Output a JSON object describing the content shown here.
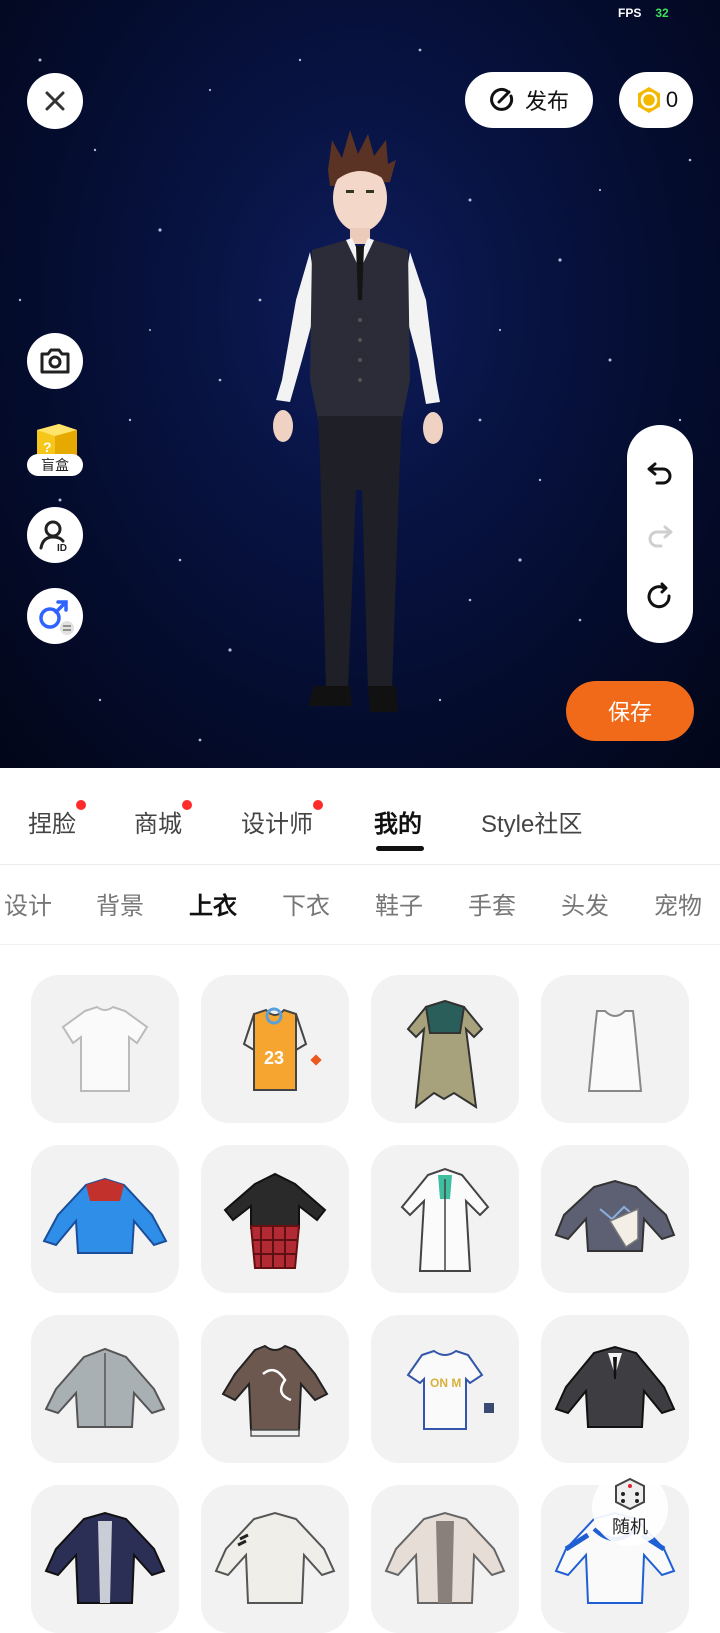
{
  "status": {
    "fps_label": "FPS",
    "fps_value": "32"
  },
  "top_bar": {
    "publish_label": "发布",
    "coins": "0"
  },
  "side_tools": {
    "blind_box_label": "盲盒"
  },
  "save_label": "保存",
  "main_tabs": [
    {
      "label": "捏脸",
      "has_dot": true
    },
    {
      "label": "商城",
      "has_dot": true
    },
    {
      "label": "设计师",
      "has_dot": true
    },
    {
      "label": "我的",
      "active": true
    },
    {
      "label": "Style社区"
    }
  ],
  "sub_tabs": [
    {
      "label": "设计"
    },
    {
      "label": "背景"
    },
    {
      "label": "上衣",
      "active": true
    },
    {
      "label": "下衣"
    },
    {
      "label": "鞋子"
    },
    {
      "label": "手套"
    },
    {
      "label": "头发"
    },
    {
      "label": "宠物"
    }
  ],
  "items": [
    {
      "icon": "white-tshirt-icon"
    },
    {
      "icon": "orange-jersey-icon"
    },
    {
      "icon": "green-robe-icon"
    },
    {
      "icon": "white-tank-top-icon"
    },
    {
      "icon": "blue-jacket-icon"
    },
    {
      "icon": "black-hoodie-plaid-icon"
    },
    {
      "icon": "white-labcoat-icon"
    },
    {
      "icon": "grey-sweater-icon"
    },
    {
      "icon": "grey-jacket-icon"
    },
    {
      "icon": "brown-tshirt-icon"
    },
    {
      "icon": "white-jersey-icon"
    },
    {
      "icon": "dark-suit-jacket-icon"
    },
    {
      "icon": "navy-jacket-icon"
    },
    {
      "icon": "white-shirt-jacket-icon"
    },
    {
      "icon": "beige-coat-icon"
    },
    {
      "icon": "white-blue-track-jacket-icon"
    }
  ],
  "random_label": "随机",
  "colors": {
    "accent": "#f06a1a",
    "tab_dot": "#ff2a2a",
    "fps_value": "#3ee05a",
    "coin": "#f5b800"
  }
}
